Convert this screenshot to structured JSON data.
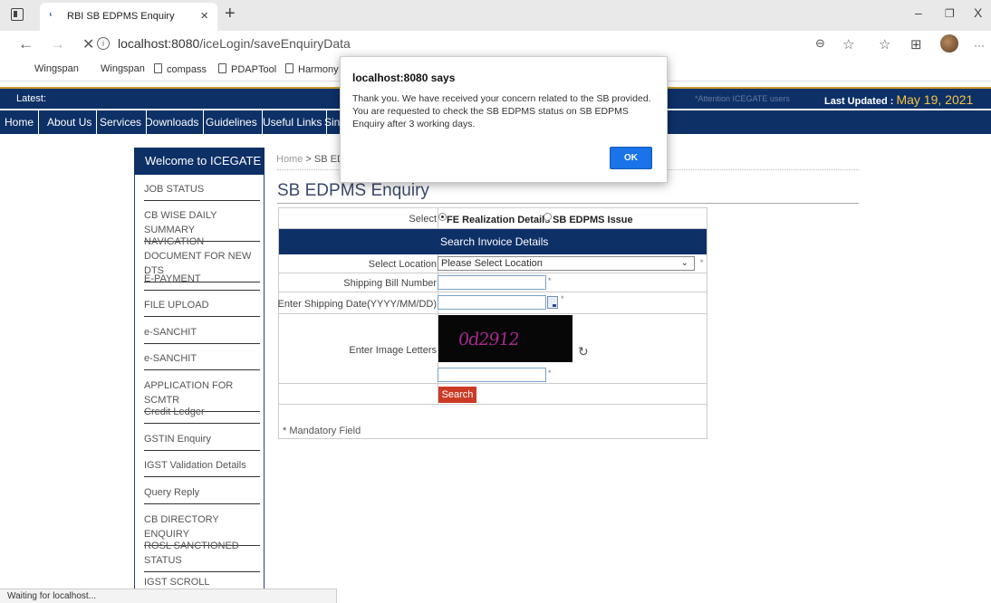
{
  "browser": {
    "tab_title": "RBI SB EDPMS Enquiry",
    "tab_close": "×",
    "new_tab": "+",
    "url_host": "localhost:8080",
    "url_path": "/iceLogin/saveEnquiryData",
    "window_controls": {
      "minimize": "–",
      "restore": "❐",
      "close": "X"
    },
    "more_menu": "···",
    "status_text": "Waiting for localhost..."
  },
  "bookmarks": [
    {
      "label": "Wingspan",
      "icon": "none"
    },
    {
      "label": "Wingspan",
      "icon": "none"
    },
    {
      "label": "compass",
      "icon": "page-icon"
    },
    {
      "label": "PDAPTool",
      "icon": "page-icon"
    },
    {
      "label": "Harmony",
      "icon": "page-icon"
    }
  ],
  "header": {
    "latest_label": "Latest:",
    "marquee_text": "*Attention ICEGATE users",
    "last_updated_label": "Last Updated :",
    "last_updated_date": "May 19, 2021"
  },
  "nav": {
    "items": [
      "Home",
      "About Us",
      "Services",
      "Downloads",
      "Guidelines",
      "Useful Links",
      "Sin"
    ]
  },
  "sidebar": {
    "heading": "Welcome to ICEGATE",
    "items": [
      "JOB STATUS",
      "CB WISE DAILY SUMMARY",
      "NAVIGATION DOCUMENT FOR NEW DTS",
      "E-PAYMENT",
      "FILE UPLOAD",
      "e-SANCHIT",
      "e-SANCHIT",
      "APPLICATION FOR SCMTR",
      "Credit Ledger",
      "GSTIN Enquiry",
      "IGST Validation Details",
      "Query Reply",
      "CB DIRECTORY ENQUIRY",
      "ROSL SANCTIONED STATUS",
      "IGST SCROLL"
    ]
  },
  "content": {
    "breadcrumb_home": "Home",
    "breadcrumb_sep": " > ",
    "breadcrumb_current": "SB ED",
    "page_title": "SB EDPMS Enquiry",
    "select_label": "Select",
    "radio_options": [
      "FE Realization Details",
      "SB EDPMS Issue"
    ],
    "radio_selected": "FE Realization Details",
    "section_title": "Search Invoice Details",
    "fields": {
      "location_label": "Select Location",
      "location_value": "Please Select Location",
      "shipping_bill_label": "Shipping Bill Number",
      "shipping_date_label": "Enter Shipping Date(YYYY/MM/DD)",
      "image_letters_label": "Enter Image Letters"
    },
    "required_mark": "*",
    "captcha_text": "0d2912",
    "search_button": "Search",
    "mandatory_note": "* Mandatory Field"
  },
  "dialog": {
    "heading": "localhost:8080 says",
    "message": "Thank you. We have received your concern related to the SB provided. You are requested to check the SB EDPMS status on SB EDPMS Enquiry after 3 working days.",
    "ok_label": "OK"
  },
  "colors": {
    "navy": "#0d3067",
    "accent_gold": "#c79a2c",
    "date_yellow": "#f4c542",
    "search_red": "#cc3a25",
    "ok_blue": "#1a73e8"
  }
}
